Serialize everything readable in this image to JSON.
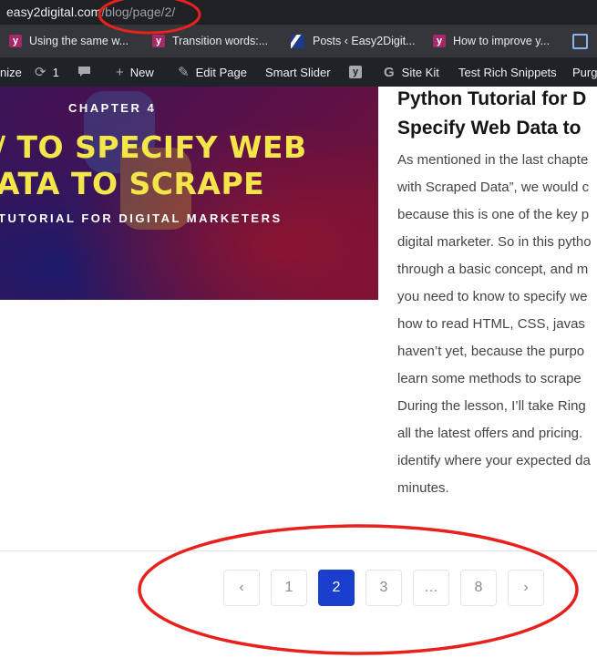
{
  "browser": {
    "url_domain": "easy2digital.com",
    "url_path": "/blog/page/2/"
  },
  "bookmarks": [
    {
      "label": "Using the same w...",
      "icon": "yoast-icon"
    },
    {
      "label": "Transition words:...",
      "icon": "yoast-icon"
    },
    {
      "label": "Posts ‹ Easy2Digit...",
      "icon": "posts-icon"
    },
    {
      "label": "How to improve y...",
      "icon": "yoast-icon"
    }
  ],
  "admin_bar": {
    "customize": "nize",
    "updates_count": "1",
    "new": "New",
    "edit_page": "Edit Page",
    "smart_slider": "Smart Slider",
    "site_kit": "Site Kit",
    "rich_snippets": "Test Rich Snippets",
    "purge": "Purg"
  },
  "hero": {
    "chapter": "CHAPTER 4",
    "line1": "/ TO SPECIFY WEB",
    "line2": "ATA TO SCRAPE",
    "subtitle": "TUTORIAL FOR DIGITAL MARKETERS"
  },
  "article": {
    "title_line1": "Python Tutorial for D",
    "title_line2": "Specify Web Data to",
    "excerpt_lines": [
      "As mentioned in the last chapte",
      "with Scraped Data”, we would c",
      "because this is one of the key p",
      "digital marketer. So in this pytho",
      "through a basic concept, and m",
      "you need to know to specify we",
      "how to read HTML, CSS, javas",
      "haven’t yet, because the purpo",
      "learn some methods to scrape",
      "During the lesson, I’ll take Ring",
      "all the latest offers and pricing.",
      "identify where your expected da",
      "minutes."
    ]
  },
  "pagination": {
    "prev": "‹",
    "pages": [
      "1",
      "2",
      "3",
      "…",
      "8"
    ],
    "current": "2",
    "next": "›",
    "active_color": "#1a3fcf"
  },
  "colors": {
    "annotation": "#e8211c",
    "hero_text": "#f4e64a"
  }
}
